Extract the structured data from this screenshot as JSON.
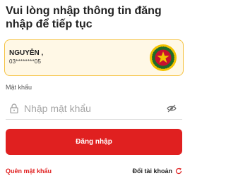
{
  "header": {
    "title": "Vui lòng nhập thông tin đăng nhập để tiếp tục"
  },
  "account": {
    "name": "NGUYỄN ,",
    "phone_masked": "03********05",
    "avatar_icon": "police-emblem-icon"
  },
  "password": {
    "label": "Mật khẩu",
    "placeholder": "Nhập mật khẩu",
    "lock_icon": "lock-icon",
    "visibility_icon": "eye-off-icon"
  },
  "actions": {
    "login_label": "Đăng nhập",
    "forgot_label": "Quên mật khẩu",
    "switch_label": "Đổi tài khoản",
    "switch_icon": "refresh-icon"
  },
  "colors": {
    "primary": "#e02020",
    "card_border": "#f5c242",
    "card_bg": "#fff8e6",
    "emblem_green": "#1f6b2a",
    "emblem_gold": "#f2c200"
  }
}
